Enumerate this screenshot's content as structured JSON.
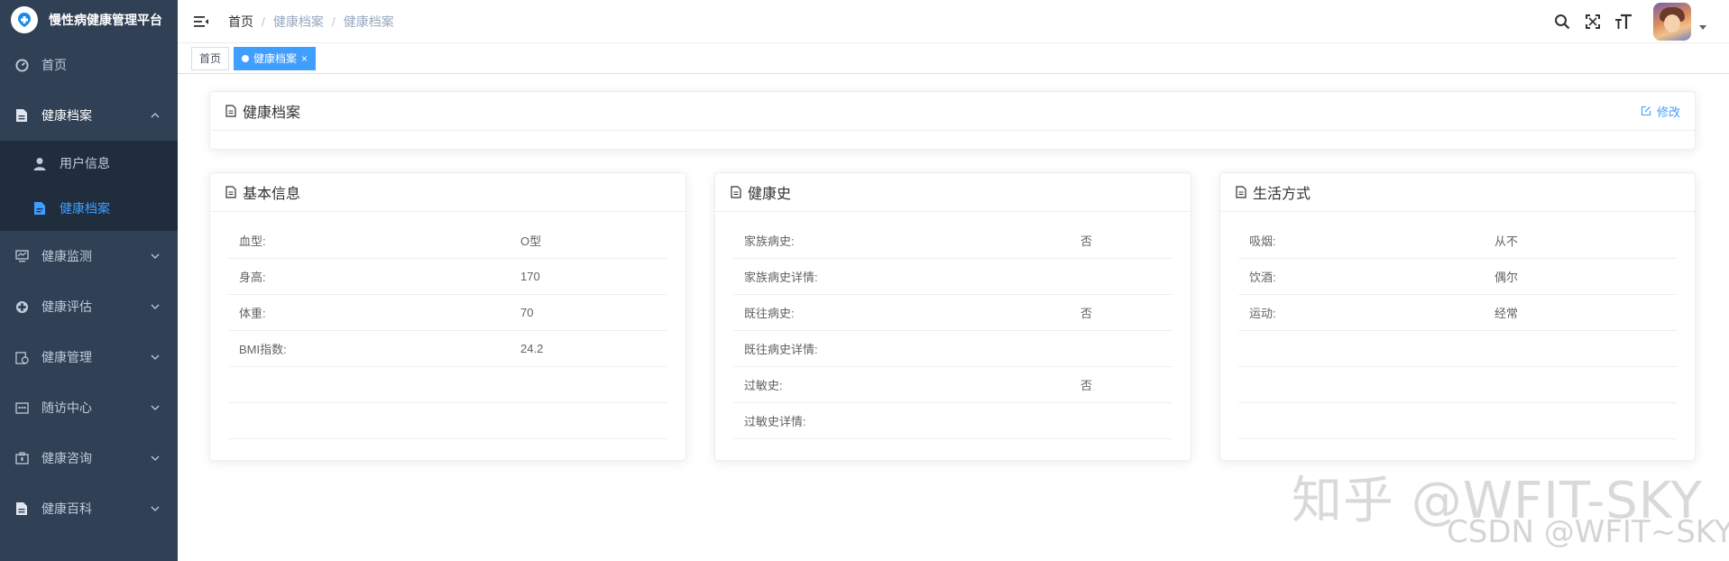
{
  "app": {
    "title": "慢性病健康管理平台"
  },
  "sidebar": {
    "items": [
      {
        "label": "首页",
        "icon": "dashboard-icon"
      },
      {
        "label": "健康档案",
        "icon": "document-icon",
        "expanded": true,
        "children": [
          {
            "label": "用户信息",
            "icon": "user-icon",
            "active": false
          },
          {
            "label": "健康档案",
            "icon": "file-icon",
            "active": true
          }
        ]
      },
      {
        "label": "健康监测",
        "icon": "monitor-icon"
      },
      {
        "label": "健康评估",
        "icon": "assessment-icon"
      },
      {
        "label": "健康管理",
        "icon": "management-icon"
      },
      {
        "label": "随访中心",
        "icon": "calendar-icon"
      },
      {
        "label": "健康咨询",
        "icon": "consult-icon"
      },
      {
        "label": "健康百科",
        "icon": "encyclopedia-icon"
      }
    ]
  },
  "breadcrumb": [
    "首页",
    "健康档案",
    "健康档案"
  ],
  "tags": [
    {
      "label": "首页",
      "active": false
    },
    {
      "label": "健康档案",
      "active": true
    }
  ],
  "archive_card": {
    "title": "健康档案",
    "edit_label": "修改"
  },
  "basic_info": {
    "title": "基本信息",
    "rows": [
      {
        "label": "血型:",
        "value": "O型"
      },
      {
        "label": "身高:",
        "value": "170"
      },
      {
        "label": "体重:",
        "value": "70"
      },
      {
        "label": "BMI指数:",
        "value": "24.2"
      },
      {
        "label": "",
        "value": ""
      },
      {
        "label": "",
        "value": ""
      }
    ]
  },
  "health_history": {
    "title": "健康史",
    "rows": [
      {
        "label": "家族病史:",
        "value": "否"
      },
      {
        "label": "家族病史详情:",
        "value": ""
      },
      {
        "label": "既往病史:",
        "value": "否"
      },
      {
        "label": "既往病史详情:",
        "value": ""
      },
      {
        "label": "过敏史:",
        "value": "否"
      },
      {
        "label": "过敏史详情:",
        "value": ""
      }
    ]
  },
  "lifestyle": {
    "title": "生活方式",
    "rows": [
      {
        "label": "吸烟:",
        "value": "从不"
      },
      {
        "label": "饮酒:",
        "value": "偶尔"
      },
      {
        "label": "运动:",
        "value": "经常"
      },
      {
        "label": "",
        "value": ""
      },
      {
        "label": "",
        "value": ""
      },
      {
        "label": "",
        "value": ""
      }
    ]
  },
  "watermarks": {
    "zhihu": "知乎 @WFIT-SKY",
    "csdn": "CSDN @WFIT~SKY"
  },
  "colors": {
    "sidebar_bg": "#304156",
    "submenu_bg": "#1f2d3d",
    "accent": "#409eff"
  }
}
